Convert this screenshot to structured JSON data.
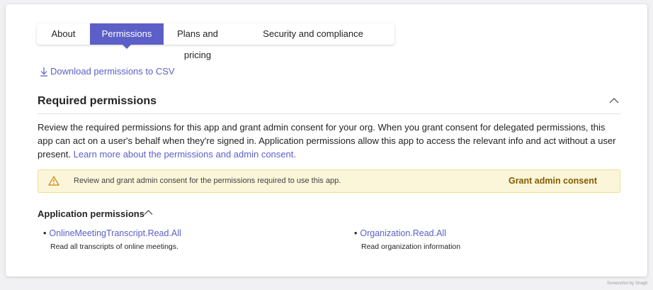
{
  "tabs": [
    "About",
    "Permissions",
    "Plans and pricing",
    "Security and compliance"
  ],
  "active_tab": "Permissions",
  "download_link": "Download permissions to CSV",
  "section": {
    "title": "Required permissions",
    "description": "Review the required permissions for this app and grant admin consent for your org. When you grant consent for delegated permissions, this app can act on a user's behalf when they're signed in. Application permissions allow this app to access the relevant info and act without a user present.",
    "learn_more": "Learn more about the permissions and admin consent."
  },
  "banner": {
    "text": "Review and grant admin consent for the permissions required to use this app.",
    "button": "Grant admin consent",
    "icon": "warning-icon"
  },
  "application_permissions": {
    "title": "Application permissions",
    "items": [
      {
        "name": "OnlineMeetingTranscript.Read.All",
        "description": "Read all transcripts of online meetings."
      },
      {
        "name": "Organization.Read.All",
        "description": "Read organization information"
      }
    ]
  },
  "watermark": "Screenshot by Snagit",
  "colors": {
    "accent": "#5b5fc7",
    "banner_bg": "#fbf6d9",
    "banner_border": "#f2dc8f",
    "grant_text": "#835b00"
  }
}
